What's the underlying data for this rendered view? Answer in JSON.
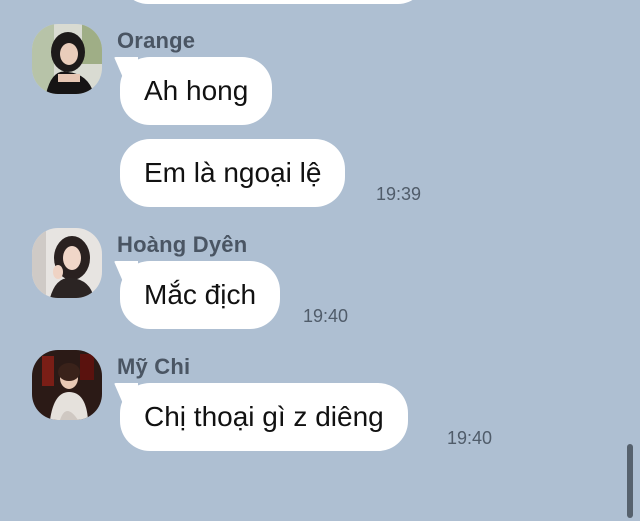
{
  "messages": [
    {
      "sender": "Orange",
      "bubbles": [
        {
          "text": "Ah hong",
          "time": ""
        },
        {
          "text": "Em là ngoại lệ",
          "time": "19:39"
        }
      ]
    },
    {
      "sender": "Hoàng Dyên",
      "bubbles": [
        {
          "text": "Mắc địch",
          "time": "19:40"
        }
      ]
    },
    {
      "sender": "Mỹ Chi",
      "bubbles": [
        {
          "text": "Chị thoại gì z diêng",
          "time": "19:40"
        }
      ]
    }
  ],
  "colors": {
    "background": "#aebfd2",
    "bubble": "#ffffff",
    "sender_name": "#4a5563",
    "timestamp": "#505c6a"
  }
}
